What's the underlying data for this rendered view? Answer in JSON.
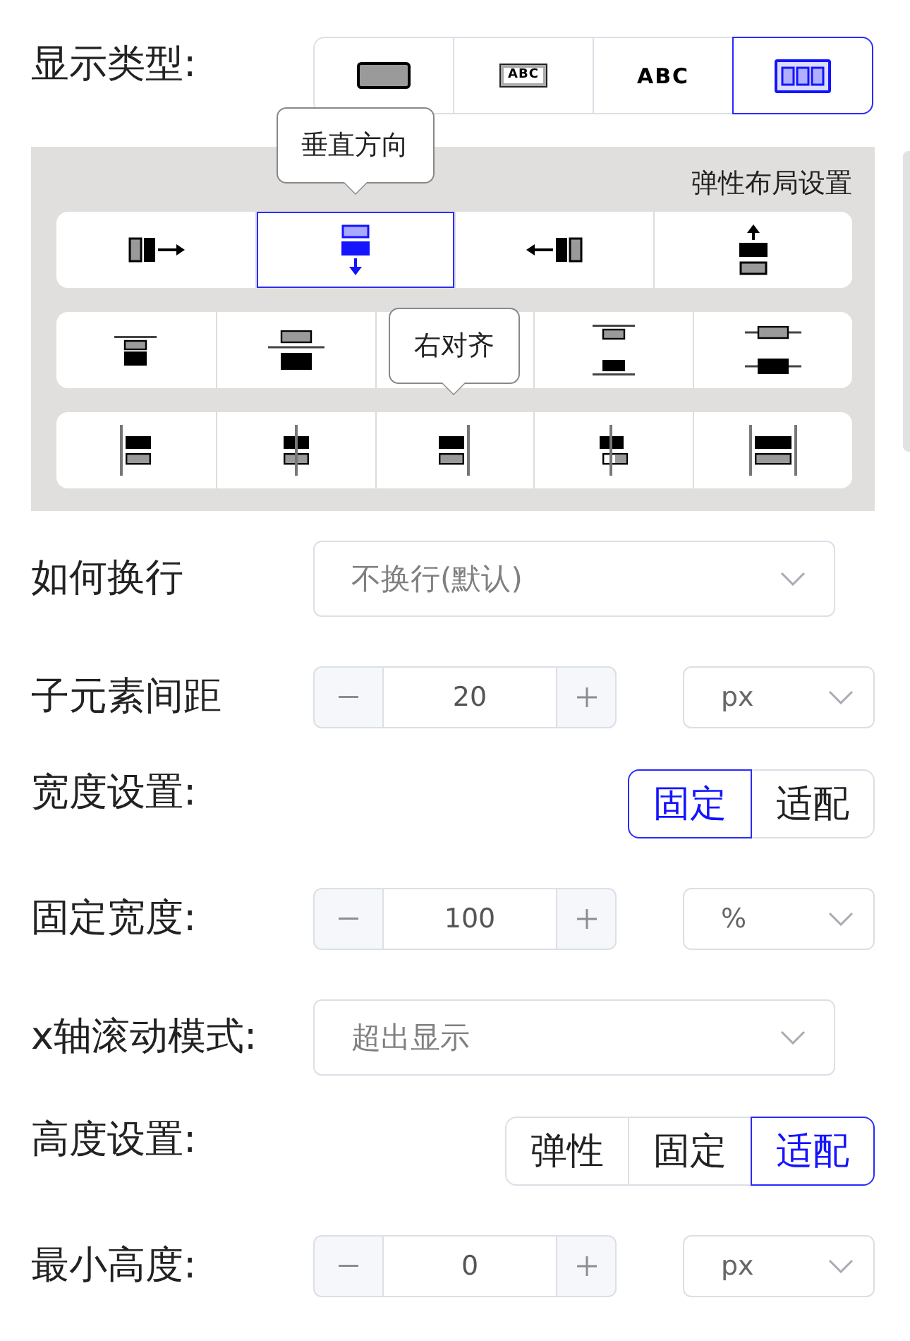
{
  "display_type": {
    "label": "显示类型:",
    "options": [
      {
        "kind": "block",
        "selected": false
      },
      {
        "kind": "inline-block",
        "label": "ABC",
        "selected": false
      },
      {
        "kind": "inline",
        "label": "ABC",
        "selected": false
      },
      {
        "kind": "flex",
        "selected": true
      }
    ]
  },
  "flex_panel": {
    "title": "弹性布局设置",
    "direction": [
      {
        "kind": "row",
        "selected": false
      },
      {
        "kind": "column",
        "selected": true,
        "tooltip": "垂直方向"
      },
      {
        "kind": "row-reverse",
        "selected": false
      },
      {
        "kind": "column-reverse",
        "selected": false
      }
    ],
    "justify": [
      {
        "kind": "start",
        "selected": false
      },
      {
        "kind": "center",
        "selected": false
      },
      {
        "selected": false
      },
      {
        "kind": "space-between",
        "selected": false
      },
      {
        "kind": "space-around",
        "selected": false
      }
    ],
    "align": [
      {
        "kind": "start",
        "selected": false
      },
      {
        "kind": "center",
        "selected": false
      },
      {
        "kind": "end",
        "selected": false,
        "tooltip": "右对齐"
      },
      {
        "kind": "baseline",
        "selected": false
      },
      {
        "kind": "stretch",
        "selected": false
      }
    ]
  },
  "fields": [
    {
      "kind": "select",
      "label": "如何换行",
      "value": "不换行(默认)"
    },
    {
      "kind": "number",
      "label": "子元素间距",
      "value": "20",
      "unit": "px"
    },
    {
      "kind": "segmented",
      "label": "宽度设置:",
      "options": [
        {
          "label": "固定",
          "selected": true
        },
        {
          "label": "适配",
          "selected": false
        }
      ]
    },
    {
      "kind": "number",
      "label": "固定宽度:",
      "value": "100",
      "unit": "%"
    },
    {
      "kind": "select",
      "label": "x轴滚动模式:",
      "value": "超出显示"
    },
    {
      "kind": "segmented",
      "label": "高度设置:",
      "options": [
        {
          "label": "弹性",
          "selected": false
        },
        {
          "label": "固定",
          "selected": false
        },
        {
          "label": "适配",
          "selected": true
        }
      ]
    },
    {
      "kind": "number",
      "label": "最小高度:",
      "value": "0",
      "unit": "px"
    }
  ]
}
